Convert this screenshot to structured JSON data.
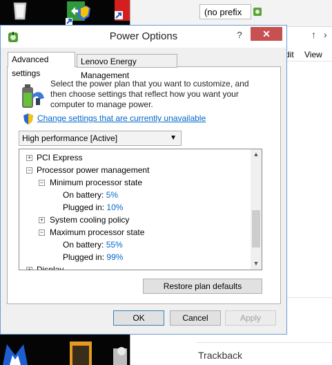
{
  "explorer": {
    "search_text": "(no prefix",
    "menu_edit": "dit",
    "menu_view": "View",
    "footer_text": "Trackback"
  },
  "dialog": {
    "title": "Power Options",
    "help": "?",
    "close": "✕",
    "tabs": [
      "Advanced settings",
      "Lenovo Energy Management"
    ],
    "intro": "Select the power plan that you want to customize, and then choose settings that reflect how you want your computer to manage power.",
    "change_link": "Change settings that are currently unavailable",
    "plan": "High performance [Active]",
    "tree": [
      {
        "label": "PCI Express"
      },
      {
        "label": "Processor power management"
      },
      {
        "label": "Minimum processor state"
      },
      {
        "label": "On battery:",
        "value": "5%"
      },
      {
        "label": "Plugged in:",
        "value": "10%"
      },
      {
        "label": "System cooling policy"
      },
      {
        "label": "Maximum processor state"
      },
      {
        "label": "On battery:",
        "value": "55%"
      },
      {
        "label": "Plugged in:",
        "value": "99%"
      },
      {
        "label": "Display"
      }
    ],
    "buttons": {
      "restore": "Restore plan defaults",
      "ok": "OK",
      "cancel": "Cancel",
      "apply": "Apply"
    }
  },
  "icons": {
    "recycle_bin": "recycle-bin-icon",
    "power": "power-options-icon",
    "shield": "uac-shield-icon"
  },
  "colors": {
    "link": "#0066cc",
    "close_button": "#c75050",
    "dialog_border": "#6b9dd6"
  }
}
